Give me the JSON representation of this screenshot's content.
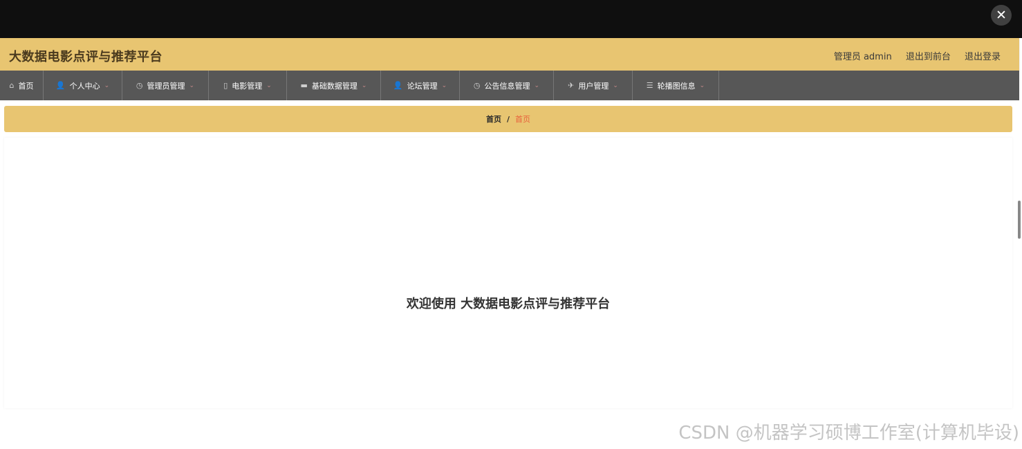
{
  "window": {
    "close_icon": "close-icon"
  },
  "header": {
    "title": "大数据电影点评与推荐平台",
    "role_label": "管理员 admin",
    "frontend_link": "退出到前台",
    "logout_link": "退出登录"
  },
  "nav": {
    "items": [
      {
        "label": "首页",
        "icon": "home-icon",
        "glyph": "⌂",
        "has_dropdown": false
      },
      {
        "label": "个人中心",
        "icon": "user-icon",
        "glyph": "👤",
        "has_dropdown": true
      },
      {
        "label": "管理员管理",
        "icon": "compass-icon",
        "glyph": "◷",
        "has_dropdown": true
      },
      {
        "label": "电影管理",
        "icon": "mobile-icon",
        "glyph": "▯",
        "has_dropdown": true
      },
      {
        "label": "基础数据管理",
        "icon": "print-icon",
        "glyph": "▬",
        "has_dropdown": true
      },
      {
        "label": "论坛管理",
        "icon": "user-icon",
        "glyph": "👤",
        "has_dropdown": true
      },
      {
        "label": "公告信息管理",
        "icon": "clock-icon",
        "glyph": "◷",
        "has_dropdown": true
      },
      {
        "label": "用户管理",
        "icon": "send-icon",
        "glyph": "✈",
        "has_dropdown": true
      },
      {
        "label": "轮播图信息",
        "icon": "sliders-icon",
        "glyph": "☰",
        "has_dropdown": true
      }
    ],
    "dropdown_glyph": "⌄"
  },
  "breadcrumb": {
    "home": "首页",
    "separator": "/",
    "current": "首页"
  },
  "main": {
    "welcome_text": "欢迎使用 大数据电影点评与推荐平台"
  },
  "watermark": "CSDN @机器学习硕博工作室(计算机毕设)",
  "colors": {
    "header_bg": "#e8c571",
    "nav_bg": "#575757",
    "topbar_bg": "#0f0f0f",
    "breadcrumb_current": "#e8603c"
  }
}
